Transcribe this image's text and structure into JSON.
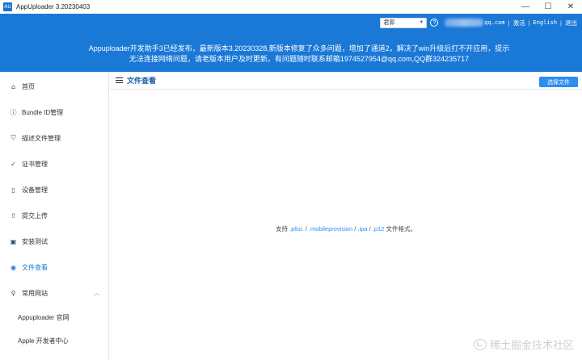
{
  "window": {
    "icon_label": "AU",
    "title": "AppUploader 3.20230403",
    "controls": [
      "—",
      "☐",
      "✕"
    ]
  },
  "header": {
    "region": "君郭",
    "email_suffix": "qq.com",
    "links": {
      "activate": "激活",
      "language": "English",
      "logout": "退出"
    },
    "notice_line1": "Appuploader开发助手3已经发布，最新版本3.20230328,新版本修复了众多问题，增加了通道2，解决了win升级后打不开应用，提示",
    "notice_line2": "无法连接网络问题，请老版本用户及时更新。有问题随时联系邮箱1974527954@qq.com,QQ群324235717"
  },
  "sidebar": {
    "items": [
      {
        "label": "首页",
        "icon": "home-icon",
        "glyph": "⌂"
      },
      {
        "label": "Bundle ID管理",
        "icon": "info-icon",
        "glyph": "ⓘ"
      },
      {
        "label": "描述文件管理",
        "icon": "profile-icon",
        "glyph": "⛉"
      },
      {
        "label": "证书管理",
        "icon": "certificate-icon",
        "glyph": "✓"
      },
      {
        "label": "设备管理",
        "icon": "device-icon",
        "glyph": "▯"
      },
      {
        "label": "提交上传",
        "icon": "upload-icon",
        "glyph": "⇧"
      },
      {
        "label": "安装测试",
        "icon": "install-icon",
        "glyph": "▣"
      },
      {
        "label": "文件查看",
        "icon": "eye-icon",
        "glyph": "◉"
      },
      {
        "label": "常用网站",
        "icon": "location-icon",
        "glyph": "⚲"
      }
    ],
    "active_index": 7,
    "sub_items": [
      "Appuploader 官网",
      "Apple 开发者中心"
    ]
  },
  "content": {
    "title": "文件查看",
    "choose_button": "选择文件",
    "support_prefix": "支持",
    "formats": [
      ".plist.",
      ".mobileprovision",
      ".ipa",
      ".p12"
    ],
    "format_sep": " / ",
    "support_suffix": "文件格式。"
  },
  "watermark": "稀土掘金技术社区",
  "colors": {
    "header_blue": "#1a78d6",
    "accent": "#2d8cf0"
  }
}
